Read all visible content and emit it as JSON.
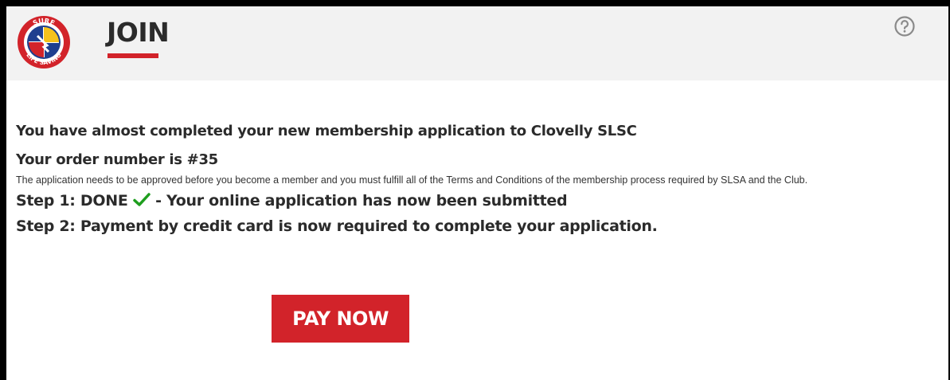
{
  "header": {
    "title": "JOIN",
    "logo": {
      "top_text": "SURF",
      "bottom_text": "LIFE SAVING"
    },
    "help_icon": "question-circle-icon"
  },
  "main": {
    "heading": "You have almost completed your new membership application to Clovelly SLSC",
    "order_line": "Your order number is #35",
    "note": "The application needs to be approved before you become a member and you must fulfill all of the Terms and Conditions of the membership process required by SLSA and the Club.",
    "step1_prefix": "Step 1: DONE",
    "step1_suffix": " - Your online application has now been submitted",
    "step1_icon": "checkmark-icon",
    "step2": "Step 2: Payment by credit card is now required to complete your application.",
    "pay_button": "PAY NOW"
  },
  "colors": {
    "accent_red": "#d2232a",
    "header_bg": "#f2f2f2",
    "check_green": "#1e9e1e",
    "logo_blue": "#1f3f8f"
  }
}
